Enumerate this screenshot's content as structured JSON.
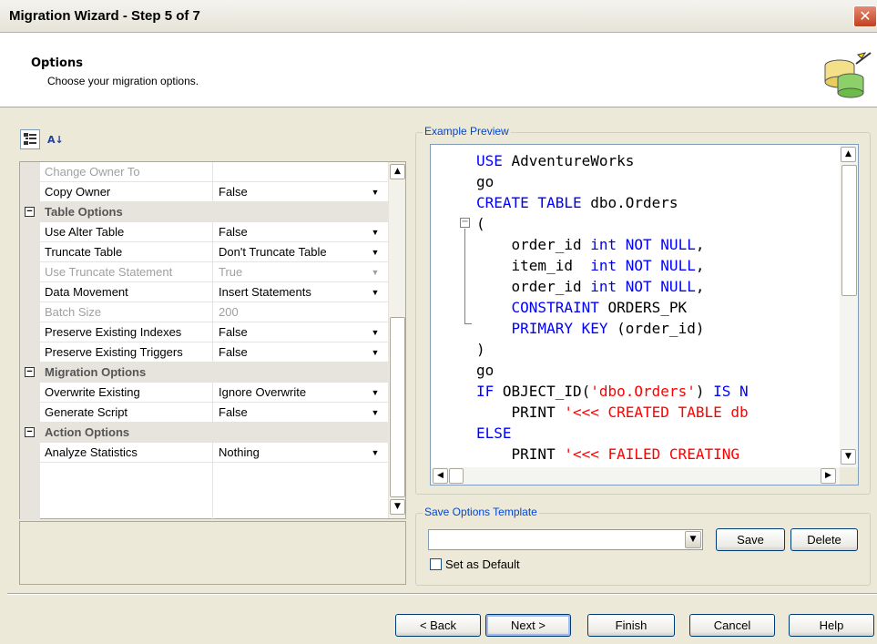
{
  "window": {
    "title": "Migration Wizard - Step 5 of 7",
    "close_glyph": "✕"
  },
  "header": {
    "title": "Options",
    "subtitle": "Choose your migration options.",
    "icon": "database-wizard-icon"
  },
  "property_grid": {
    "toolbar": {
      "categorized_icon": "categorized-icon",
      "alphabetical_icon": "sort-alphabetical-icon",
      "alpha_glyph": "A↓"
    },
    "collapse_glyph": "−",
    "dropdown_glyph": "▼",
    "rows": [
      {
        "type": "prop",
        "name": "Change Owner To",
        "value": "",
        "disabled": true,
        "dropdown": false
      },
      {
        "type": "prop",
        "name": "Copy Owner",
        "value": "False",
        "disabled": false,
        "dropdown": true
      },
      {
        "type": "category",
        "name": "Table Options"
      },
      {
        "type": "prop",
        "name": "Use Alter Table",
        "value": "False",
        "disabled": false,
        "dropdown": true
      },
      {
        "type": "prop",
        "name": "Truncate Table",
        "value": "Don't Truncate Table",
        "disabled": false,
        "dropdown": true
      },
      {
        "type": "prop",
        "name": "Use Truncate Statement",
        "value": "True",
        "disabled": true,
        "dropdown": true
      },
      {
        "type": "prop",
        "name": "Data Movement",
        "value": "Insert Statements",
        "disabled": false,
        "dropdown": true
      },
      {
        "type": "prop",
        "name": "Batch Size",
        "value": "200",
        "disabled": true,
        "dropdown": false
      },
      {
        "type": "prop",
        "name": "Preserve Existing Indexes",
        "value": "False",
        "disabled": false,
        "dropdown": true
      },
      {
        "type": "prop",
        "name": "Preserve Existing Triggers",
        "value": "False",
        "disabled": false,
        "dropdown": true
      },
      {
        "type": "category",
        "name": "Migration Options"
      },
      {
        "type": "prop",
        "name": "Overwrite Existing",
        "value": "Ignore Overwrite",
        "disabled": false,
        "dropdown": true
      },
      {
        "type": "prop",
        "name": "Generate Script",
        "value": "False",
        "disabled": false,
        "dropdown": true
      },
      {
        "type": "category",
        "name": "Action Options"
      },
      {
        "type": "prop",
        "name": "Analyze Statistics",
        "value": "Nothing",
        "disabled": false,
        "dropdown": true
      }
    ],
    "scroll_up_glyph": "▲",
    "scroll_down_glyph": "▼"
  },
  "example_preview": {
    "label": "Example Preview",
    "fold_glyph": "−",
    "lines": [
      [
        {
          "t": "USE",
          "c": "kw"
        },
        {
          "t": " AdventureWorks",
          "c": ""
        }
      ],
      [
        {
          "t": "go",
          "c": ""
        }
      ],
      [
        {
          "t": "CREATE TABLE",
          "c": "kw"
        },
        {
          "t": " dbo.Orders",
          "c": ""
        }
      ],
      [
        {
          "t": "(",
          "c": ""
        }
      ],
      [
        {
          "t": "    order_id ",
          "c": ""
        },
        {
          "t": "int NOT NULL",
          "c": "kw"
        },
        {
          "t": ",",
          "c": ""
        }
      ],
      [
        {
          "t": "    item_id  ",
          "c": ""
        },
        {
          "t": "int NOT NULL",
          "c": "kw"
        },
        {
          "t": ",",
          "c": ""
        }
      ],
      [
        {
          "t": "    order_id ",
          "c": ""
        },
        {
          "t": "int NOT NULL",
          "c": "kw"
        },
        {
          "t": ",",
          "c": ""
        }
      ],
      [
        {
          "t": "    ",
          "c": ""
        },
        {
          "t": "CONSTRAINT",
          "c": "kw"
        },
        {
          "t": " ORDERS_PK",
          "c": ""
        }
      ],
      [
        {
          "t": "    ",
          "c": ""
        },
        {
          "t": "PRIMARY KEY",
          "c": "kw"
        },
        {
          "t": " (order_id)",
          "c": ""
        }
      ],
      [
        {
          "t": ")",
          "c": ""
        }
      ],
      [
        {
          "t": "go",
          "c": ""
        }
      ],
      [
        {
          "t": "IF",
          "c": "kw"
        },
        {
          "t": " OBJECT_ID(",
          "c": ""
        },
        {
          "t": "'dbo.Orders'",
          "c": "str"
        },
        {
          "t": ") ",
          "c": ""
        },
        {
          "t": "IS N",
          "c": "kw"
        }
      ],
      [
        {
          "t": "    PRINT ",
          "c": ""
        },
        {
          "t": "'<<< CREATED TABLE db",
          "c": "str"
        }
      ],
      [
        {
          "t": "ELSE",
          "c": "kw"
        }
      ],
      [
        {
          "t": "    PRINT ",
          "c": ""
        },
        {
          "t": "'<<< FAILED CREATING",
          "c": "str"
        }
      ]
    ],
    "scroll_up_glyph": "▲",
    "scroll_down_glyph": "▼",
    "scroll_left_glyph": "◀",
    "scroll_right_glyph": "▶"
  },
  "save_options": {
    "label": "Save Options Template",
    "template_value": "",
    "save_label": "Save",
    "delete_label": "Delete",
    "set_default_label": "Set as Default",
    "set_default_checked": false,
    "dropdown_glyph": "▼"
  },
  "footer": {
    "back_label": "< Back",
    "next_label": "Next >",
    "finish_label": "Finish",
    "cancel_label": "Cancel",
    "help_label": "Help"
  }
}
